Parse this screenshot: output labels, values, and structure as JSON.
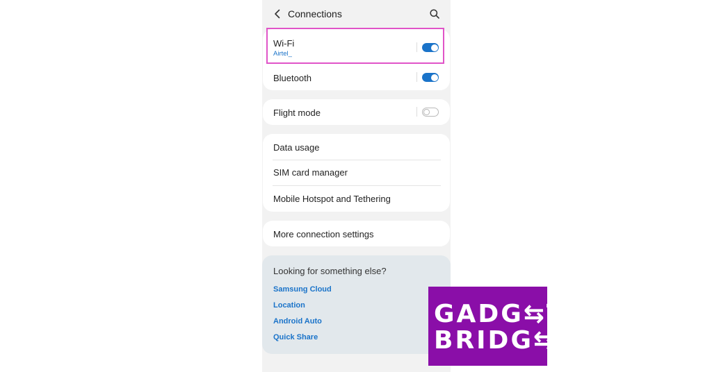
{
  "header": {
    "title": "Connections",
    "back_icon": "back-arrow-icon",
    "search_icon": "search-icon"
  },
  "wifi": {
    "label": "Wi-Fi",
    "network": "Airtel_",
    "enabled": true
  },
  "bluetooth": {
    "label": "Bluetooth",
    "enabled": true
  },
  "flight_mode": {
    "label": "Flight mode",
    "enabled": false
  },
  "data_group": {
    "items": [
      "Data usage",
      "SIM card manager",
      "Mobile Hotspot and Tethering"
    ]
  },
  "more_settings": {
    "label": "More connection settings"
  },
  "suggestions": {
    "heading": "Looking for something else?",
    "links": [
      "Samsung Cloud",
      "Location",
      "Android Auto",
      "Quick Share"
    ]
  },
  "watermark": {
    "line1": "GADG⇆T",
    "line2": "BRIDG⇆"
  },
  "colors": {
    "accent": "#1a73c9",
    "highlight": "#e054c8",
    "logo_bg": "#8a0ea8"
  }
}
